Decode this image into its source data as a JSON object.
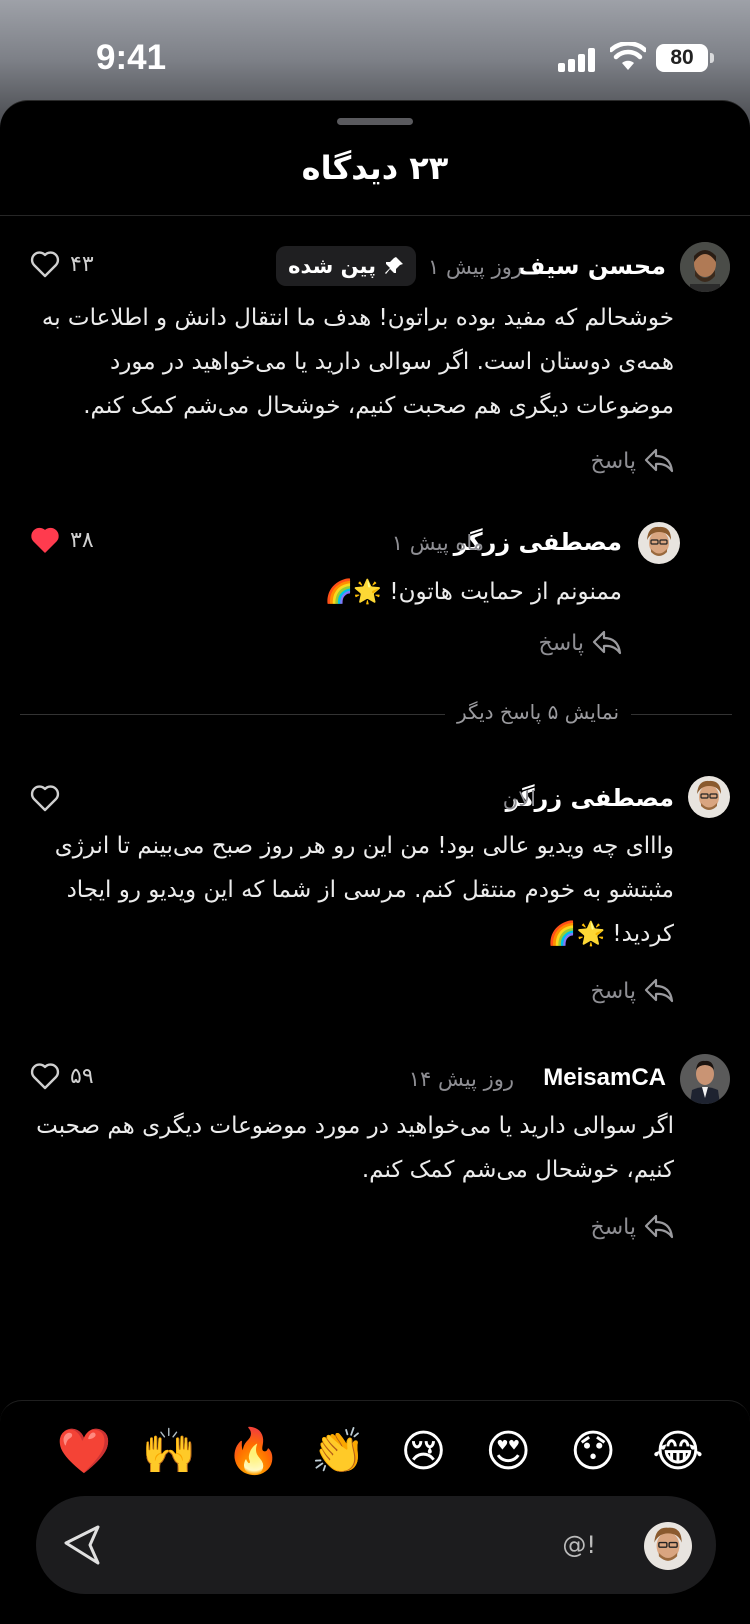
{
  "status": {
    "time": "9:41",
    "battery": "80"
  },
  "sheet": {
    "title": "۲۳ دیدگاه"
  },
  "comments": [
    {
      "name": "محسن سیف",
      "time": "۱ روز پیش",
      "pinned": "پین شده",
      "text": "خوشحالم که مفید بوده براتون! هدف ما انتقال دانش و اطلاعات به همه‌ی دوستان است. اگر سوالی دارید یا می‌خواهید در مورد موضوعات دیگری هم صحبت کنیم، خوشحال می‌شم کمک کنم.",
      "likes": "۴۳",
      "reply": "پاسخ"
    },
    {
      "name": "مصطفی زرگر",
      "time": "۱ ماه پیش",
      "text": "ممنونم از حمایت هاتون! 🌟🌈",
      "likes": "۳۸",
      "reply": "پاسخ"
    },
    {
      "name": "مصطفی زرگر",
      "time": "الان",
      "text": "وااای چه ویدیو عالی بود! من این رو هر روز صبح می‌بینم تا انرژی مثبتشو به خودم منتقل کنم. مرسی از شما که این ویدیو رو ایجاد کردید! 🌟🌈",
      "likes": "",
      "reply": "پاسخ"
    },
    {
      "name": "MeisamCA",
      "time": "۱۴ روز پیش",
      "text": "اگر سوالی دارید یا می‌خواهید در مورد موضوعات دیگری هم صحبت کنیم، خوشحال می‌شم کمک کنم.",
      "likes": "۵۹",
      "reply": "پاسخ"
    }
  ],
  "more_replies": "نمایش ۵ پاسخ دیگر",
  "reactions": [
    "😂",
    "😯",
    "😍",
    "😢",
    "👏",
    "🔥",
    "🙌",
    "❤️"
  ],
  "composer": {
    "placeholder": "!@"
  },
  "colors": {
    "like_red": "#ff3b4e",
    "muted": "#8e8e93",
    "sheet_bg": "#000000"
  }
}
